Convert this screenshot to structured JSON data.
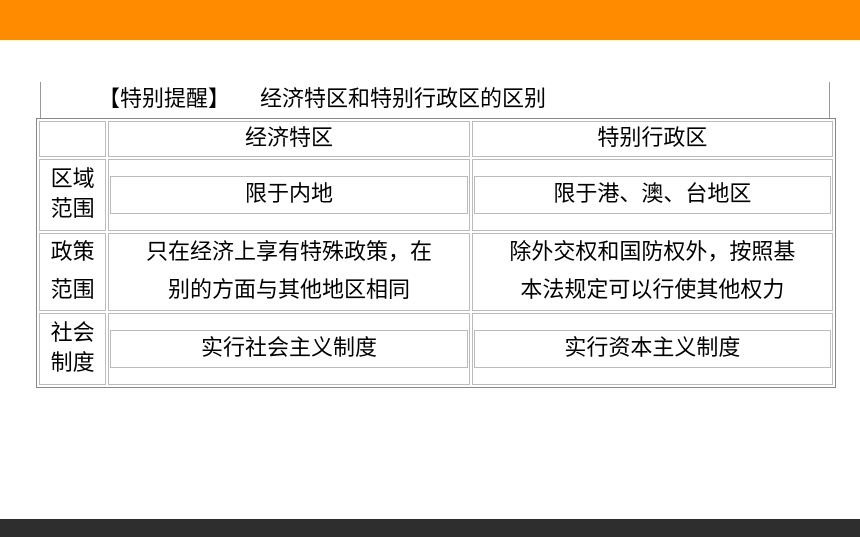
{
  "heading": {
    "tag": "【特别提醒】",
    "title": "经济特区和特别行政区的区别"
  },
  "table": {
    "headers": [
      "",
      "经济特区",
      "特别行政区"
    ],
    "rows": [
      {
        "label_lines": [
          "区域",
          "范围"
        ],
        "col1_lines": [
          "限于内地"
        ],
        "col2_lines": [
          "限于港、澳、台地区"
        ]
      },
      {
        "label_lines": [
          "政策",
          "范围"
        ],
        "col1_lines": [
          "只在经济上享有特殊政策，在",
          "别的方面与其他地区相同"
        ],
        "col2_lines": [
          "除外交权和国防权外，按照基",
          "本法规定可以行使其他权力"
        ]
      },
      {
        "label_lines": [
          "社会",
          "制度"
        ],
        "col1_lines": [
          "实行社会主义制度"
        ],
        "col2_lines": [
          "实行资本主义制度"
        ]
      }
    ]
  },
  "colors": {
    "top_bar": "#ff8c00",
    "bottom_bar": "#2e2e2e"
  }
}
